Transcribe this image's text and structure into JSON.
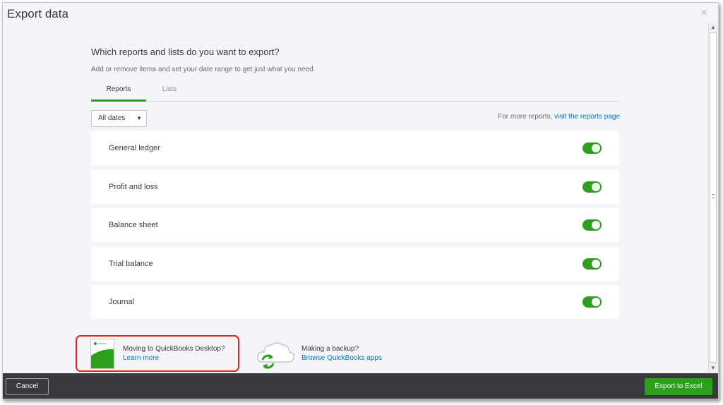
{
  "dialog": {
    "title": "Export data",
    "close_icon": "close-icon"
  },
  "main": {
    "heading": "Which reports and lists do you want to export?",
    "subheading": "Add or remove items and set your date range to get just what you need.",
    "tabs": [
      {
        "label": "Reports",
        "active": true
      },
      {
        "label": "Lists",
        "active": false
      }
    ],
    "date_filter": {
      "value": "All dates",
      "icon": "caret-down-icon"
    },
    "more_reports": {
      "text": "For more reports, ",
      "link": "visit the reports page"
    },
    "reports": [
      {
        "label": "General ledger",
        "enabled": true
      },
      {
        "label": "Profit and loss",
        "enabled": true
      },
      {
        "label": "Balance sheet",
        "enabled": true
      },
      {
        "label": "Trial balance",
        "enabled": true
      },
      {
        "label": "Journal",
        "enabled": true
      }
    ]
  },
  "promos": [
    {
      "title": "Moving to QuickBooks Desktop?",
      "link": "Learn more",
      "icon": "desktop-app-icon"
    },
    {
      "title": "Making a backup?",
      "link": "Browse QuickBooks apps",
      "icon": "cloud-sync-icon"
    }
  ],
  "footer": {
    "cancel_label": "Cancel",
    "export_label": "Export to Excel"
  },
  "colors": {
    "accent_green": "#2ca01c",
    "link_blue": "#0077c5",
    "footer_bg": "#393a3d",
    "highlight_red": "#e02424"
  }
}
